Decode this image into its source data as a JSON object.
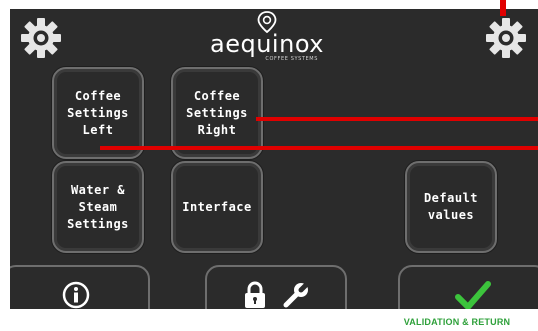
{
  "brand": {
    "name": "aequinox",
    "subtitle": "COFFEE SYSTEMS"
  },
  "menu": {
    "coffee_left": "Coffee\nSettings\nLeft",
    "coffee_right": "Coffee\nSettings\nRight",
    "water_steam": "Water &\nSteam\nSettings",
    "interface": "Interface",
    "default_values": "Default\nvalues"
  },
  "bottom_bar": {
    "info_icon": "info-icon",
    "lock_icon": "lock-icon",
    "wrench_icon": "wrench-icon",
    "confirm_icon": "checkmark-icon"
  },
  "annotation": {
    "footer": "VALIDATION & RETURN"
  },
  "colors": {
    "screen_bg": "#2b2b2b",
    "highlight_red": "#e00000",
    "confirm_green": "#2ea03a"
  }
}
